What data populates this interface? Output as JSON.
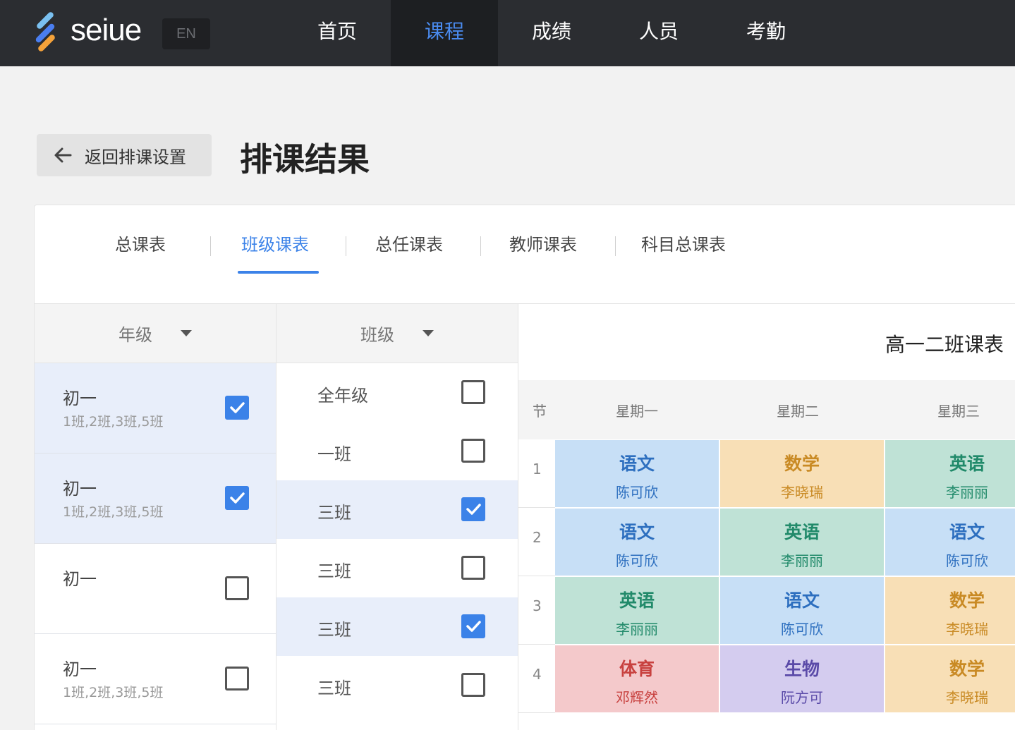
{
  "brand": {
    "name": "seiue",
    "lang": "EN"
  },
  "nav": [
    {
      "label": "首页",
      "active": false
    },
    {
      "label": "课程",
      "active": true
    },
    {
      "label": "成绩",
      "active": false
    },
    {
      "label": "人员",
      "active": false
    },
    {
      "label": "考勤",
      "active": false
    }
  ],
  "header": {
    "back_label": "返回排课设置",
    "title": "排课结果"
  },
  "tabs": [
    {
      "label": "总课表",
      "active": false
    },
    {
      "label": "班级课表",
      "active": true
    },
    {
      "label": "总任课表",
      "active": false
    },
    {
      "label": "教师课表",
      "active": false
    },
    {
      "label": "科目总课表",
      "active": false
    }
  ],
  "grade_filter": {
    "header": "年级",
    "rows": [
      {
        "name": "初一",
        "sub": "1班,2班,3班,5班",
        "checked": true
      },
      {
        "name": "初一",
        "sub": "1班,2班,3班,5班",
        "checked": true
      },
      {
        "name": "初一",
        "sub": "",
        "checked": false
      },
      {
        "name": "初一",
        "sub": "1班,2班,3班,5班",
        "checked": false
      }
    ]
  },
  "class_filter": {
    "header": "班级",
    "rows": [
      {
        "name": "全年级",
        "checked": false
      },
      {
        "name": "一班",
        "checked": false
      },
      {
        "name": "三班",
        "checked": true
      },
      {
        "name": "三班",
        "checked": false
      },
      {
        "name": "三班",
        "checked": true
      },
      {
        "name": "三班",
        "checked": false
      }
    ]
  },
  "timetable": {
    "title": "高一二班课表",
    "period_header": "节",
    "days": [
      "星期一",
      "星期二",
      "星期三"
    ],
    "periods": [
      {
        "num": "1",
        "cells": [
          {
            "subject": "语文",
            "teacher": "陈可欣",
            "color": "blue"
          },
          {
            "subject": "数学",
            "teacher": "李晓瑞",
            "color": "orange"
          },
          {
            "subject": "英语",
            "teacher": "李丽丽",
            "color": "green"
          }
        ]
      },
      {
        "num": "2",
        "cells": [
          {
            "subject": "语文",
            "teacher": "陈可欣",
            "color": "blue"
          },
          {
            "subject": "英语",
            "teacher": "李丽丽",
            "color": "green"
          },
          {
            "subject": "语文",
            "teacher": "陈可欣",
            "color": "blue"
          }
        ]
      },
      {
        "num": "3",
        "cells": [
          {
            "subject": "英语",
            "teacher": "李丽丽",
            "color": "green"
          },
          {
            "subject": "语文",
            "teacher": "陈可欣",
            "color": "blue"
          },
          {
            "subject": "数学",
            "teacher": "李晓瑞",
            "color": "orange"
          }
        ]
      },
      {
        "num": "4",
        "cells": [
          {
            "subject": "体育",
            "teacher": "邓辉然",
            "color": "red"
          },
          {
            "subject": "生物",
            "teacher": "阮方可",
            "color": "purple"
          },
          {
            "subject": "数学",
            "teacher": "李晓瑞",
            "color": "orange"
          }
        ]
      }
    ]
  },
  "colors": {
    "accent": "#3b82e8",
    "nav_bg": "#2b2d31",
    "selected_row": "#e8eefa"
  }
}
